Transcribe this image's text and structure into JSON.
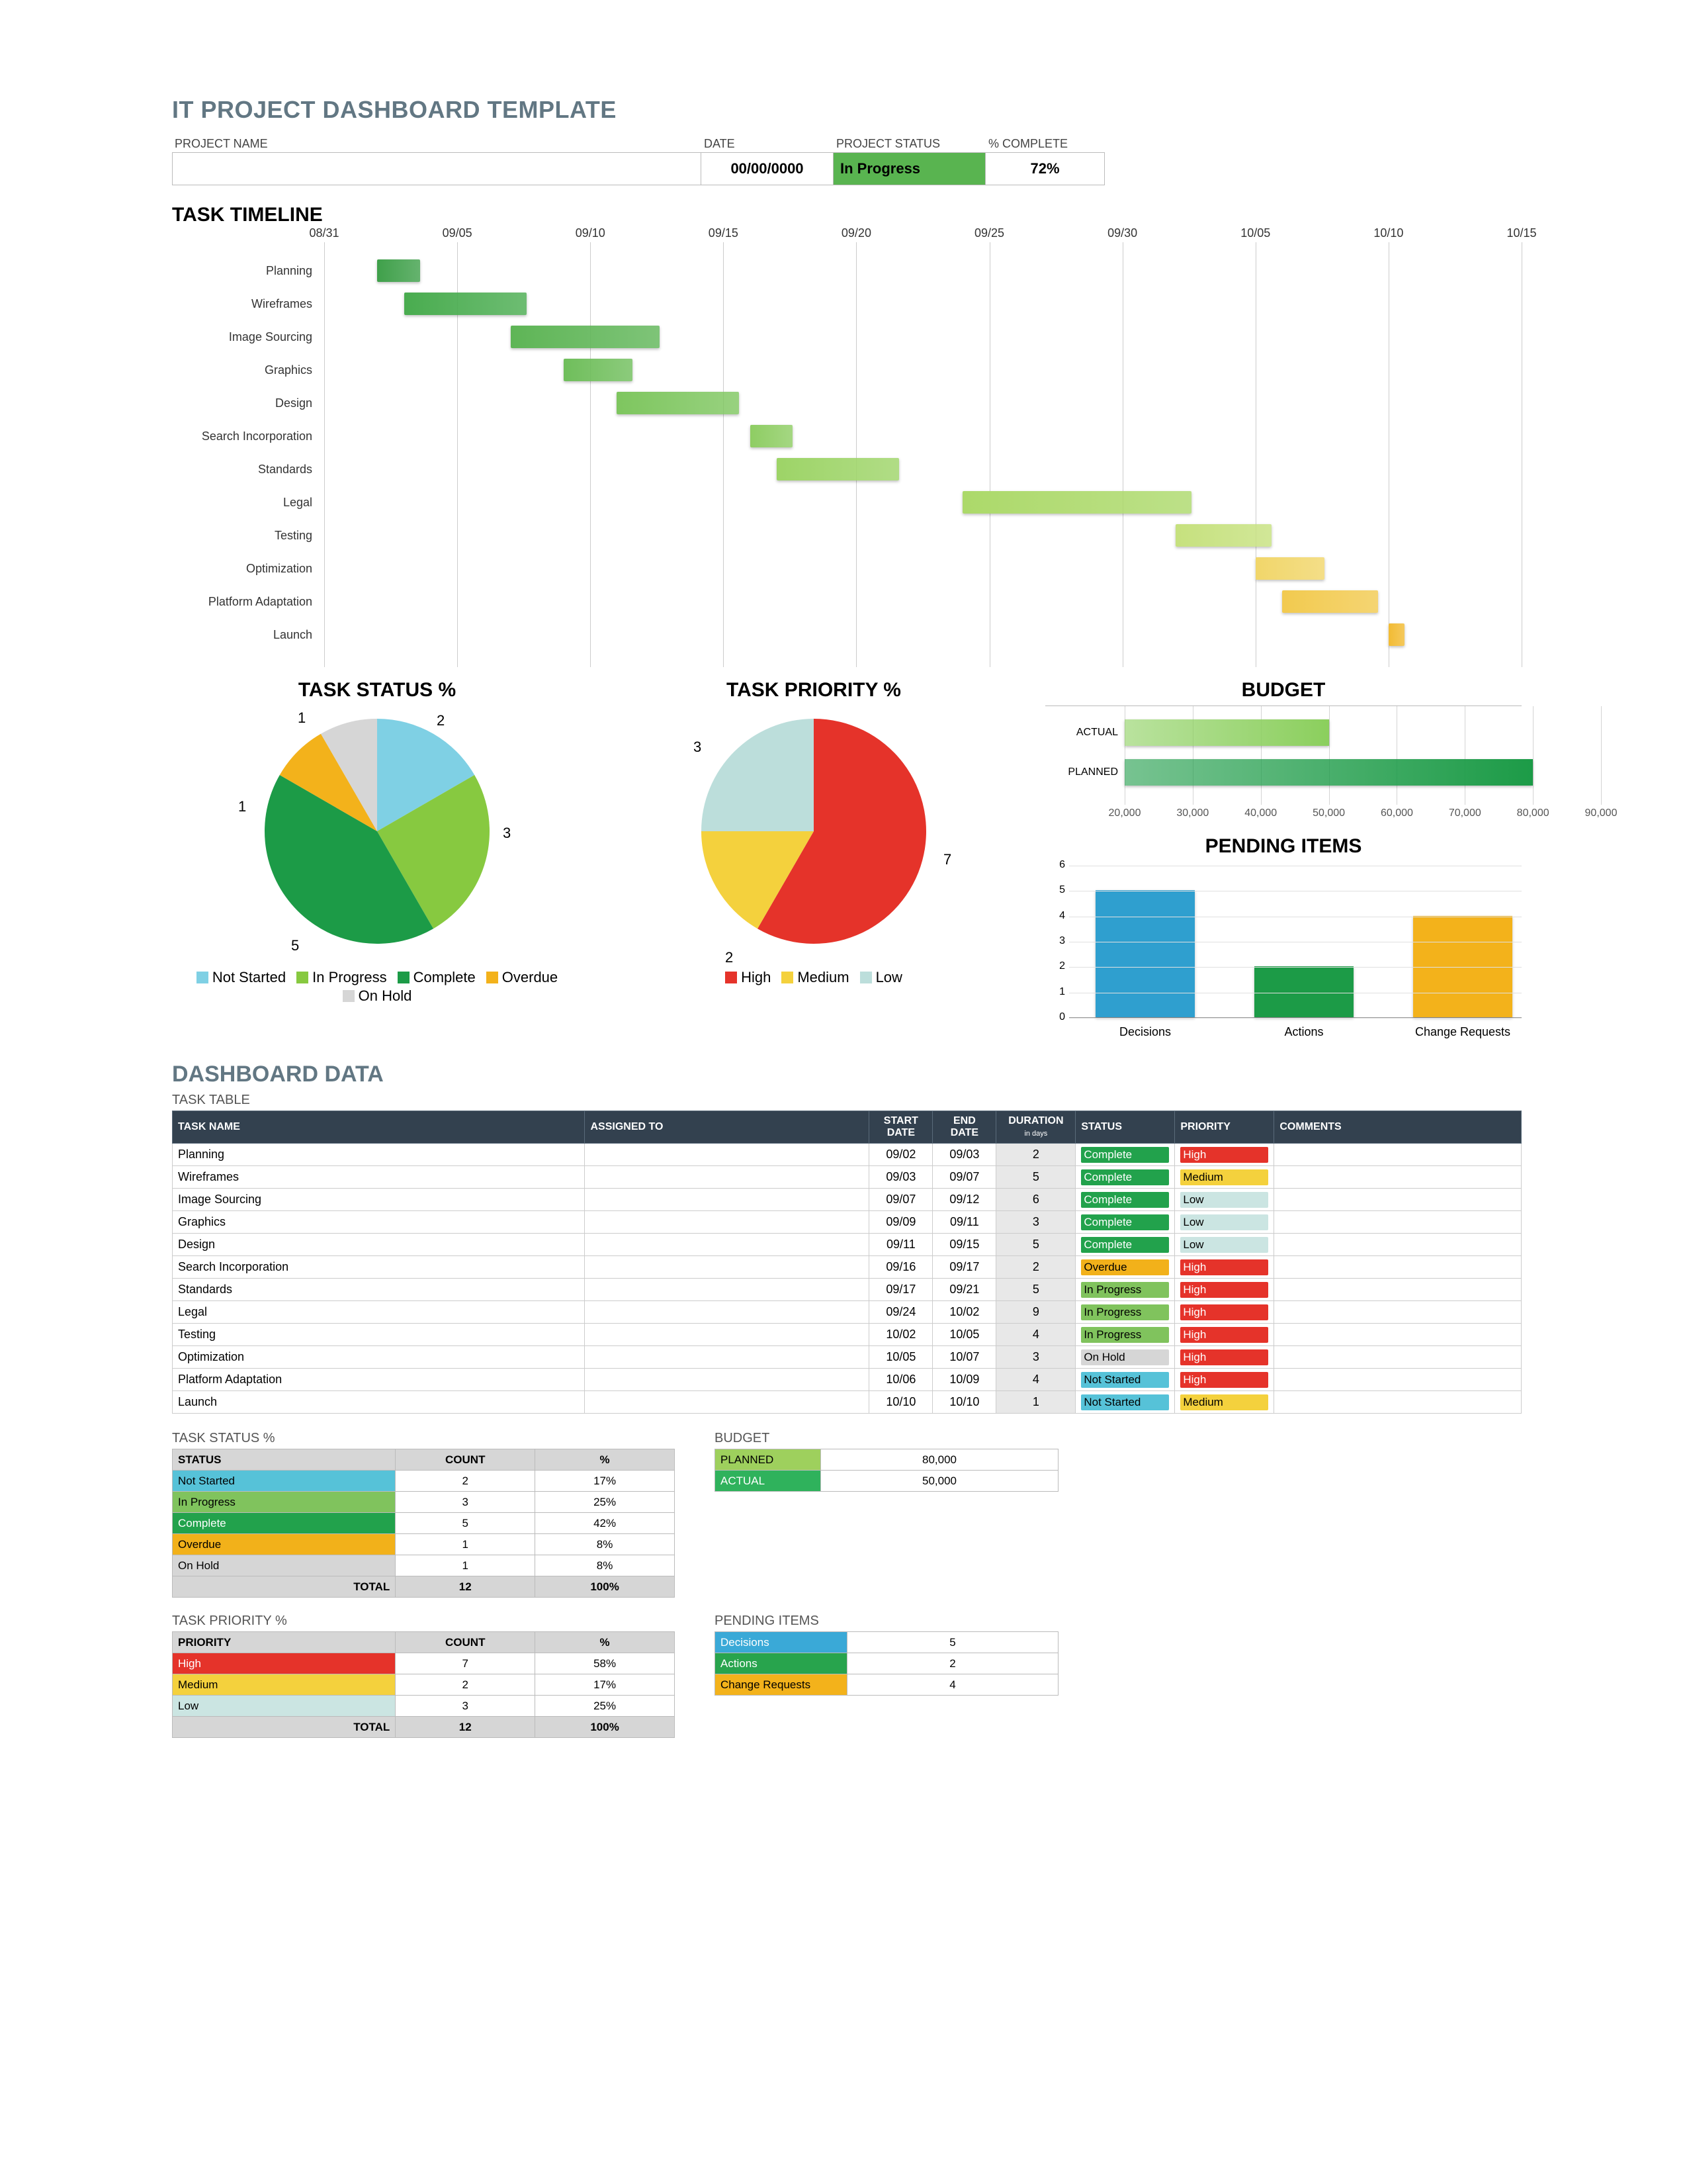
{
  "page": {
    "title": "IT PROJECT DASHBOARD TEMPLATE",
    "labels": {
      "project_name": "PROJECT NAME",
      "date": "DATE",
      "project_status": "PROJECT  STATUS",
      "pct_complete": "% COMPLETE"
    },
    "values": {
      "project_name": "",
      "date": "00/00/0000",
      "project_status": "In Progress",
      "pct_complete": "72%"
    }
  },
  "sections": {
    "timeline": "TASK TIMELINE",
    "status": "TASK STATUS %",
    "priority": "TASK PRIORITY %",
    "budget": "BUDGET",
    "pending": "PENDING ITEMS",
    "dash": "DASHBOARD DATA",
    "task_table": "TASK TABLE",
    "status_pct": "TASK STATUS %",
    "priority_pct": "TASK PRIORITY %",
    "budget_sm": "BUDGET",
    "pending_sm": "PENDING ITEMS"
  },
  "chart_data": [
    {
      "id": "gantt",
      "type": "gantt",
      "xlabel": "",
      "ylabel": "",
      "x_ticks": [
        "08/31",
        "09/05",
        "09/10",
        "09/15",
        "09/20",
        "09/25",
        "09/30",
        "10/05",
        "10/10",
        "10/15"
      ],
      "x_range": [
        "08/31",
        "10/15"
      ],
      "tasks": [
        {
          "name": "Planning",
          "start": "09/02",
          "end": "09/03",
          "color": "#3fa04a"
        },
        {
          "name": "Wireframes",
          "start": "09/03",
          "end": "09/07",
          "color": "#49ac4f"
        },
        {
          "name": "Image Sourcing",
          "start": "09/07",
          "end": "09/12",
          "color": "#5eb556"
        },
        {
          "name": "Graphics",
          "start": "09/09",
          "end": "09/11",
          "color": "#6fbe5b"
        },
        {
          "name": "Design",
          "start": "09/11",
          "end": "09/15",
          "color": "#7ec65f"
        },
        {
          "name": "Search Incorporation",
          "start": "09/16",
          "end": "09/17",
          "color": "#8ecd63"
        },
        {
          "name": "Standards",
          "start": "09/17",
          "end": "09/21",
          "color": "#9dd467"
        },
        {
          "name": "Legal",
          "start": "09/24",
          "end": "10/02",
          "color": "#acd96a"
        },
        {
          "name": "Testing",
          "start": "10/02",
          "end": "10/05",
          "color": "#c6e17e"
        },
        {
          "name": "Optimization",
          "start": "10/05",
          "end": "10/07",
          "color": "#f1d66a"
        },
        {
          "name": "Platform Adaptation",
          "start": "10/06",
          "end": "10/09",
          "color": "#f2ca4f"
        },
        {
          "name": "Launch",
          "start": "10/10",
          "end": "10/10",
          "color": "#f2bb33"
        }
      ]
    },
    {
      "id": "task_status_pie",
      "type": "pie",
      "title": "TASK STATUS %",
      "series": [
        {
          "name": "Not Started",
          "value": 2,
          "color": "#7fd0e4"
        },
        {
          "name": "In Progress",
          "value": 3,
          "color": "#87c940"
        },
        {
          "name": "Complete",
          "value": 5,
          "color": "#1c9b47"
        },
        {
          "name": "Overdue",
          "value": 1,
          "color": "#f3b21b"
        },
        {
          "name": "On Hold",
          "value": 1,
          "color": "#d6d6d6"
        }
      ]
    },
    {
      "id": "task_priority_pie",
      "type": "pie",
      "title": "TASK PRIORITY %",
      "series": [
        {
          "name": "High",
          "value": 7,
          "color": "#e5332a"
        },
        {
          "name": "Medium",
          "value": 2,
          "color": "#f4d13d"
        },
        {
          "name": "Low",
          "value": 3,
          "color": "#bcdedb"
        }
      ]
    },
    {
      "id": "budget_bar",
      "type": "bar",
      "orientation": "horizontal",
      "title": "BUDGET",
      "xlim": [
        20000,
        90000
      ],
      "x_ticks": [
        20000,
        30000,
        40000,
        50000,
        60000,
        70000,
        80000,
        90000
      ],
      "x_tick_labels": [
        "20,000",
        "30,000",
        "40,000",
        "50,000",
        "60,000",
        "70,000",
        "80,000",
        "90,000"
      ],
      "series": [
        {
          "name": "ACTUAL",
          "value": 50000,
          "color": "#8bcf5d"
        },
        {
          "name": "PLANNED",
          "value": 80000,
          "color": "#1c9b47"
        }
      ]
    },
    {
      "id": "pending_bar",
      "type": "bar",
      "orientation": "vertical",
      "title": "PENDING ITEMS",
      "ylim": [
        0,
        6
      ],
      "y_ticks": [
        0,
        1,
        2,
        3,
        4,
        5,
        6
      ],
      "series": [
        {
          "name": "Decisions",
          "value": 5,
          "color": "#2f9fcf"
        },
        {
          "name": "Actions",
          "value": 2,
          "color": "#1c9b47"
        },
        {
          "name": "Change Requests",
          "value": 4,
          "color": "#f3b21b"
        }
      ]
    }
  ],
  "task_table": {
    "headers": [
      "TASK NAME",
      "ASSIGNED TO",
      "START DATE",
      "END DATE",
      "DURATION in days",
      "STATUS",
      "PRIORITY",
      "COMMENTS"
    ],
    "rows": [
      {
        "task": "Planning",
        "ass": "",
        "start": "09/02",
        "end": "09/03",
        "dur": "2",
        "status": "Complete",
        "prio": "High",
        "comm": ""
      },
      {
        "task": "Wireframes",
        "ass": "",
        "start": "09/03",
        "end": "09/07",
        "dur": "5",
        "status": "Complete",
        "prio": "Medium",
        "comm": ""
      },
      {
        "task": "Image Sourcing",
        "ass": "",
        "start": "09/07",
        "end": "09/12",
        "dur": "6",
        "status": "Complete",
        "prio": "Low",
        "comm": ""
      },
      {
        "task": "Graphics",
        "ass": "",
        "start": "09/09",
        "end": "09/11",
        "dur": "3",
        "status": "Complete",
        "prio": "Low",
        "comm": ""
      },
      {
        "task": "Design",
        "ass": "",
        "start": "09/11",
        "end": "09/15",
        "dur": "5",
        "status": "Complete",
        "prio": "Low",
        "comm": ""
      },
      {
        "task": "Search Incorporation",
        "ass": "",
        "start": "09/16",
        "end": "09/17",
        "dur": "2",
        "status": "Overdue",
        "prio": "High",
        "comm": ""
      },
      {
        "task": "Standards",
        "ass": "",
        "start": "09/17",
        "end": "09/21",
        "dur": "5",
        "status": "In Progress",
        "prio": "High",
        "comm": ""
      },
      {
        "task": "Legal",
        "ass": "",
        "start": "09/24",
        "end": "10/02",
        "dur": "9",
        "status": "In Progress",
        "prio": "High",
        "comm": ""
      },
      {
        "task": "Testing",
        "ass": "",
        "start": "10/02",
        "end": "10/05",
        "dur": "4",
        "status": "In Progress",
        "prio": "High",
        "comm": ""
      },
      {
        "task": "Optimization",
        "ass": "",
        "start": "10/05",
        "end": "10/07",
        "dur": "3",
        "status": "On Hold",
        "prio": "High",
        "comm": ""
      },
      {
        "task": "Platform Adaptation",
        "ass": "",
        "start": "10/06",
        "end": "10/09",
        "dur": "4",
        "status": "Not Started",
        "prio": "High",
        "comm": ""
      },
      {
        "task": "Launch",
        "ass": "",
        "start": "10/10",
        "end": "10/10",
        "dur": "1",
        "status": "Not Started",
        "prio": "Medium",
        "comm": ""
      }
    ]
  },
  "status_table": {
    "headers": [
      "STATUS",
      "COUNT",
      "%"
    ],
    "rows": [
      {
        "name": "Not Started",
        "count": "2",
        "pct": "17%",
        "cls": "c-notstarted"
      },
      {
        "name": "In Progress",
        "count": "3",
        "pct": "25%",
        "cls": "c-inprogress"
      },
      {
        "name": "Complete",
        "count": "5",
        "pct": "42%",
        "cls": "c-complete"
      },
      {
        "name": "Overdue",
        "count": "1",
        "pct": "8%",
        "cls": "c-overdue"
      },
      {
        "name": "On Hold",
        "count": "1",
        "pct": "8%",
        "cls": "c-onhold"
      }
    ],
    "total_label": "TOTAL",
    "total_count": "12",
    "total_pct": "100%"
  },
  "priority_table": {
    "headers": [
      "PRIORITY",
      "COUNT",
      "%"
    ],
    "rows": [
      {
        "name": "High",
        "count": "7",
        "pct": "58%",
        "cls": "c-high"
      },
      {
        "name": "Medium",
        "count": "2",
        "pct": "17%",
        "cls": "c-medium"
      },
      {
        "name": "Low",
        "count": "3",
        "pct": "25%",
        "cls": "c-low"
      }
    ],
    "total_label": "TOTAL",
    "total_count": "12",
    "total_pct": "100%"
  },
  "budget_table": {
    "rows": [
      {
        "name": "PLANNED",
        "value": "80,000",
        "cls": "c-planned"
      },
      {
        "name": "ACTUAL",
        "value": "50,000",
        "cls": "c-actual"
      }
    ]
  },
  "pending_table": {
    "rows": [
      {
        "name": "Decisions",
        "value": "5",
        "cls": "c-decisions"
      },
      {
        "name": "Actions",
        "value": "2",
        "cls": "c-actions"
      },
      {
        "name": "Change Requests",
        "value": "4",
        "cls": "c-changes"
      }
    ]
  }
}
